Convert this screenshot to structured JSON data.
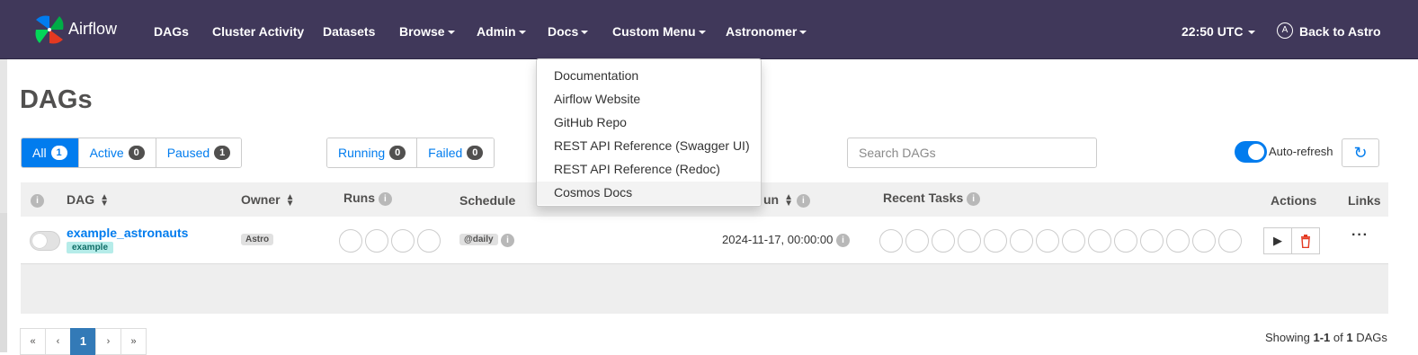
{
  "navbar": {
    "brand": "Airflow",
    "items": [
      {
        "label": "DAGs",
        "dropdown": false
      },
      {
        "label": "Cluster Activity",
        "dropdown": false
      },
      {
        "label": "Datasets",
        "dropdown": false
      },
      {
        "label": "Browse",
        "dropdown": true
      },
      {
        "label": "Admin",
        "dropdown": true
      },
      {
        "label": "Docs",
        "dropdown": true
      },
      {
        "label": "Custom Menu",
        "dropdown": true
      },
      {
        "label": "Astronomer",
        "dropdown": true
      }
    ],
    "time": "22:50 UTC",
    "back_link": "Back to Astro",
    "back_icon_letter": "A",
    "colors": {
      "bg": "#40385a",
      "accent": "#017cee"
    }
  },
  "page": {
    "title": "DAGs"
  },
  "filters": {
    "status": [
      {
        "label": "All",
        "count": "1",
        "active": true
      },
      {
        "label": "Active",
        "count": "0"
      },
      {
        "label": "Paused",
        "count": "1"
      }
    ],
    "runs": [
      {
        "label": "Running",
        "count": "0"
      },
      {
        "label": "Failed",
        "count": "0"
      }
    ]
  },
  "search": {
    "placeholder": "Search DAGs"
  },
  "auto_refresh": {
    "label": "Auto-refresh",
    "enabled": true
  },
  "table": {
    "headers": {
      "dag": "DAG",
      "owner": "Owner",
      "runs": "Runs",
      "schedule": "Schedule",
      "next_run_partial": "un",
      "recent_tasks": "Recent Tasks",
      "actions": "Actions",
      "links": "Links"
    },
    "rows": [
      {
        "dag_id": "example_astronauts",
        "tag": "example",
        "owner": "Astro",
        "schedule": "@daily",
        "next_run": "2024-11-17, 00:00:00",
        "runs_circles": 4,
        "recent_task_circles": 14,
        "paused": true
      }
    ]
  },
  "pagination": {
    "first": "«",
    "prev": "‹",
    "current": "1",
    "next": "›",
    "last": "»",
    "showing_prefix": "Showing",
    "showing_range": "1-1",
    "showing_of": "of",
    "showing_total": "1",
    "showing_suffix": "DAGs"
  },
  "docs_dropdown": {
    "items": [
      "Documentation",
      "Airflow Website",
      "GitHub Repo",
      "REST API Reference (Swagger UI)",
      "REST API Reference (Redoc)",
      "Cosmos Docs"
    ],
    "hovered_index": 5
  }
}
